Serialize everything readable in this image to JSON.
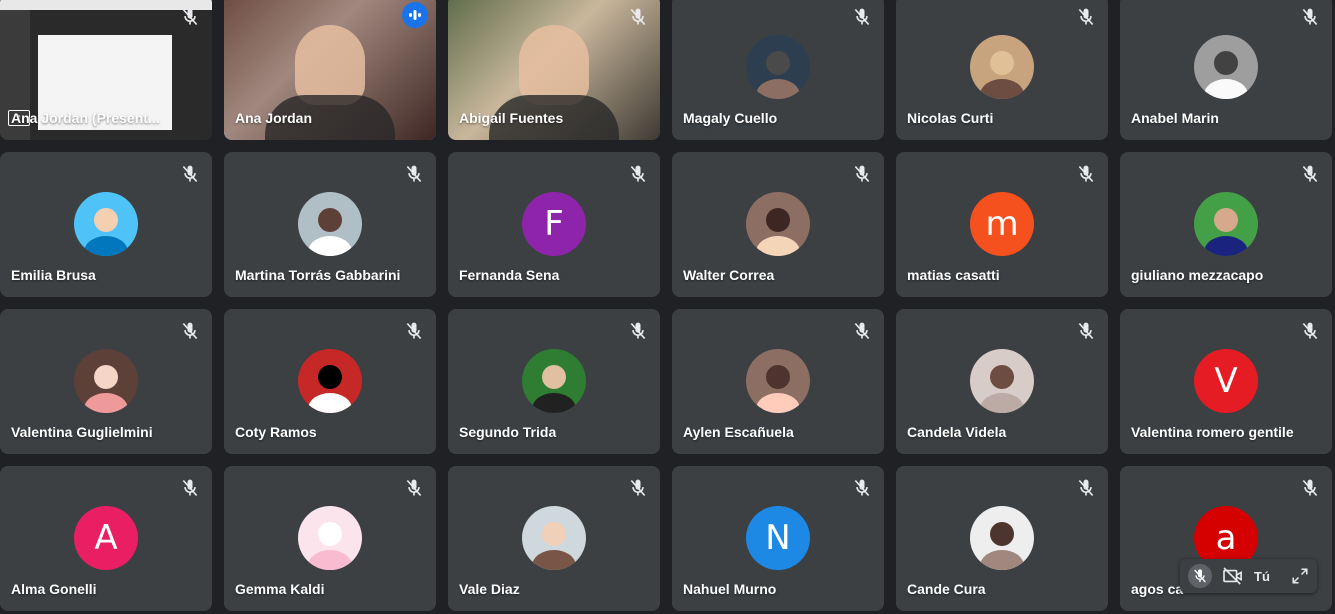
{
  "tiles": [
    {
      "name": "Ana Jordan (Presentando)",
      "label": "Ana Jordan (Present...",
      "kind": "presentation",
      "muted": true
    },
    {
      "name": "Ana Jordan",
      "kind": "video",
      "speaking": true,
      "muted": false
    },
    {
      "name": "Abigail Fuentes",
      "kind": "video",
      "muted": true
    },
    {
      "name": "Magaly Cuello",
      "kind": "photo",
      "muted": true
    },
    {
      "name": "Nicolas Curti",
      "kind": "photo",
      "muted": true
    },
    {
      "name": "Anabel Marin",
      "kind": "photo",
      "muted": true
    },
    {
      "name": "Emilia Brusa",
      "kind": "photo",
      "muted": true
    },
    {
      "name": "Martina Torrás Gabbarini",
      "kind": "photo",
      "muted": true
    },
    {
      "name": "Fernanda Sena",
      "kind": "letter",
      "letter": "F",
      "color": "#8e24aa",
      "muted": true
    },
    {
      "name": "Walter Correa",
      "kind": "photo",
      "muted": true
    },
    {
      "name": "matias casatti",
      "kind": "letter",
      "letter": "m",
      "color": "#f4511e",
      "muted": true
    },
    {
      "name": "giuliano mezzacapo",
      "kind": "photo",
      "muted": true
    },
    {
      "name": "Valentina Guglielmini",
      "kind": "photo",
      "muted": true
    },
    {
      "name": "Coty Ramos",
      "kind": "photo",
      "muted": true
    },
    {
      "name": "Segundo Trida",
      "kind": "photo",
      "muted": true
    },
    {
      "name": "Aylen Escañuela",
      "kind": "photo",
      "muted": true
    },
    {
      "name": "Candela Videla",
      "kind": "photo",
      "muted": true
    },
    {
      "name": "Valentina romero gentile",
      "kind": "letter",
      "letter": "V",
      "color": "#e51c23",
      "muted": true
    },
    {
      "name": "Alma Gonelli",
      "kind": "letter",
      "letter": "A",
      "color": "#e91e63",
      "muted": true
    },
    {
      "name": "Gemma Kaldi",
      "kind": "photo",
      "muted": true
    },
    {
      "name": "Vale Diaz",
      "kind": "photo",
      "muted": true
    },
    {
      "name": "Nahuel Murno",
      "kind": "letter",
      "letter": "N",
      "color": "#1e88e5",
      "muted": true
    },
    {
      "name": "Cande Cura",
      "kind": "photo",
      "muted": true
    },
    {
      "name": "agos ca",
      "kind": "letter",
      "letter": "a",
      "color": "#d50000",
      "muted": true
    }
  ],
  "self_view": {
    "label": "Tú"
  }
}
